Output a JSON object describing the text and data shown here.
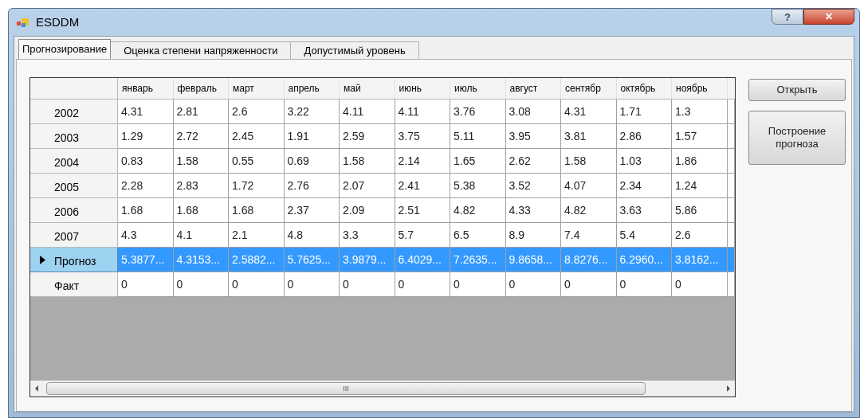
{
  "window": {
    "title": "ESDDM",
    "help": "?",
    "close": "×"
  },
  "tabs": [
    {
      "label": "Прогнозирование",
      "selected": true
    },
    {
      "label": "Оценка степени напряженности",
      "selected": false
    },
    {
      "label": "Допустимый уровень",
      "selected": false
    }
  ],
  "table": {
    "columns": [
      "январь",
      "февраль",
      "март",
      "апрель",
      "май",
      "июнь",
      "июль",
      "август",
      "сентябр",
      "октябрь",
      "ноябрь"
    ],
    "rows": [
      {
        "header": "2002",
        "selected": false,
        "cells": [
          "4.31",
          "2.81",
          "2.6",
          "3.22",
          "4.11",
          "4.11",
          "3.76",
          "3.08",
          "4.31",
          "1.71",
          "1.3"
        ]
      },
      {
        "header": "2003",
        "selected": false,
        "cells": [
          "1.29",
          "2.72",
          "2.45",
          "1.91",
          "2.59",
          "3.75",
          "5.11",
          "3.95",
          "3.81",
          "2.86",
          "1.57"
        ]
      },
      {
        "header": "2004",
        "selected": false,
        "cells": [
          "0.83",
          "1.58",
          "0.55",
          "0.69",
          "1.58",
          "2.14",
          "1.65",
          "2.62",
          "1.58",
          "1.03",
          "1.86"
        ]
      },
      {
        "header": "2005",
        "selected": false,
        "cells": [
          "2.28",
          "2.83",
          "1.72",
          "2.76",
          "2.07",
          "2.41",
          "5.38",
          "3.52",
          "4.07",
          "2.34",
          "1.24"
        ]
      },
      {
        "header": "2006",
        "selected": false,
        "cells": [
          "1.68",
          "1.68",
          "1.68",
          "2.37",
          "2.09",
          "2.51",
          "4.82",
          "4.33",
          "4.82",
          "3.63",
          "5.86"
        ]
      },
      {
        "header": "2007",
        "selected": false,
        "cells": [
          "4.3",
          "4.1",
          "2.1",
          "4.8",
          "3.3",
          "5.7",
          "6.5",
          "8.9",
          "7.4",
          "5.4",
          "2.6"
        ]
      },
      {
        "header": "Прогноз",
        "selected": true,
        "cells": [
          "5.3877...",
          "4.3153...",
          "2.5882...",
          "5.7625...",
          "3.9879...",
          "6.4029...",
          "7.2635...",
          "9.8658...",
          "8.8276...",
          "6.2960...",
          "3.8162..."
        ]
      },
      {
        "header": "Факт",
        "selected": false,
        "cells": [
          "0",
          "0",
          "0",
          "0",
          "0",
          "0",
          "0",
          "0",
          "0",
          "0",
          "0"
        ]
      }
    ]
  },
  "scrollbar": {
    "thumb": "III"
  },
  "buttons": [
    "Открыть",
    "Построение прогноза"
  ]
}
